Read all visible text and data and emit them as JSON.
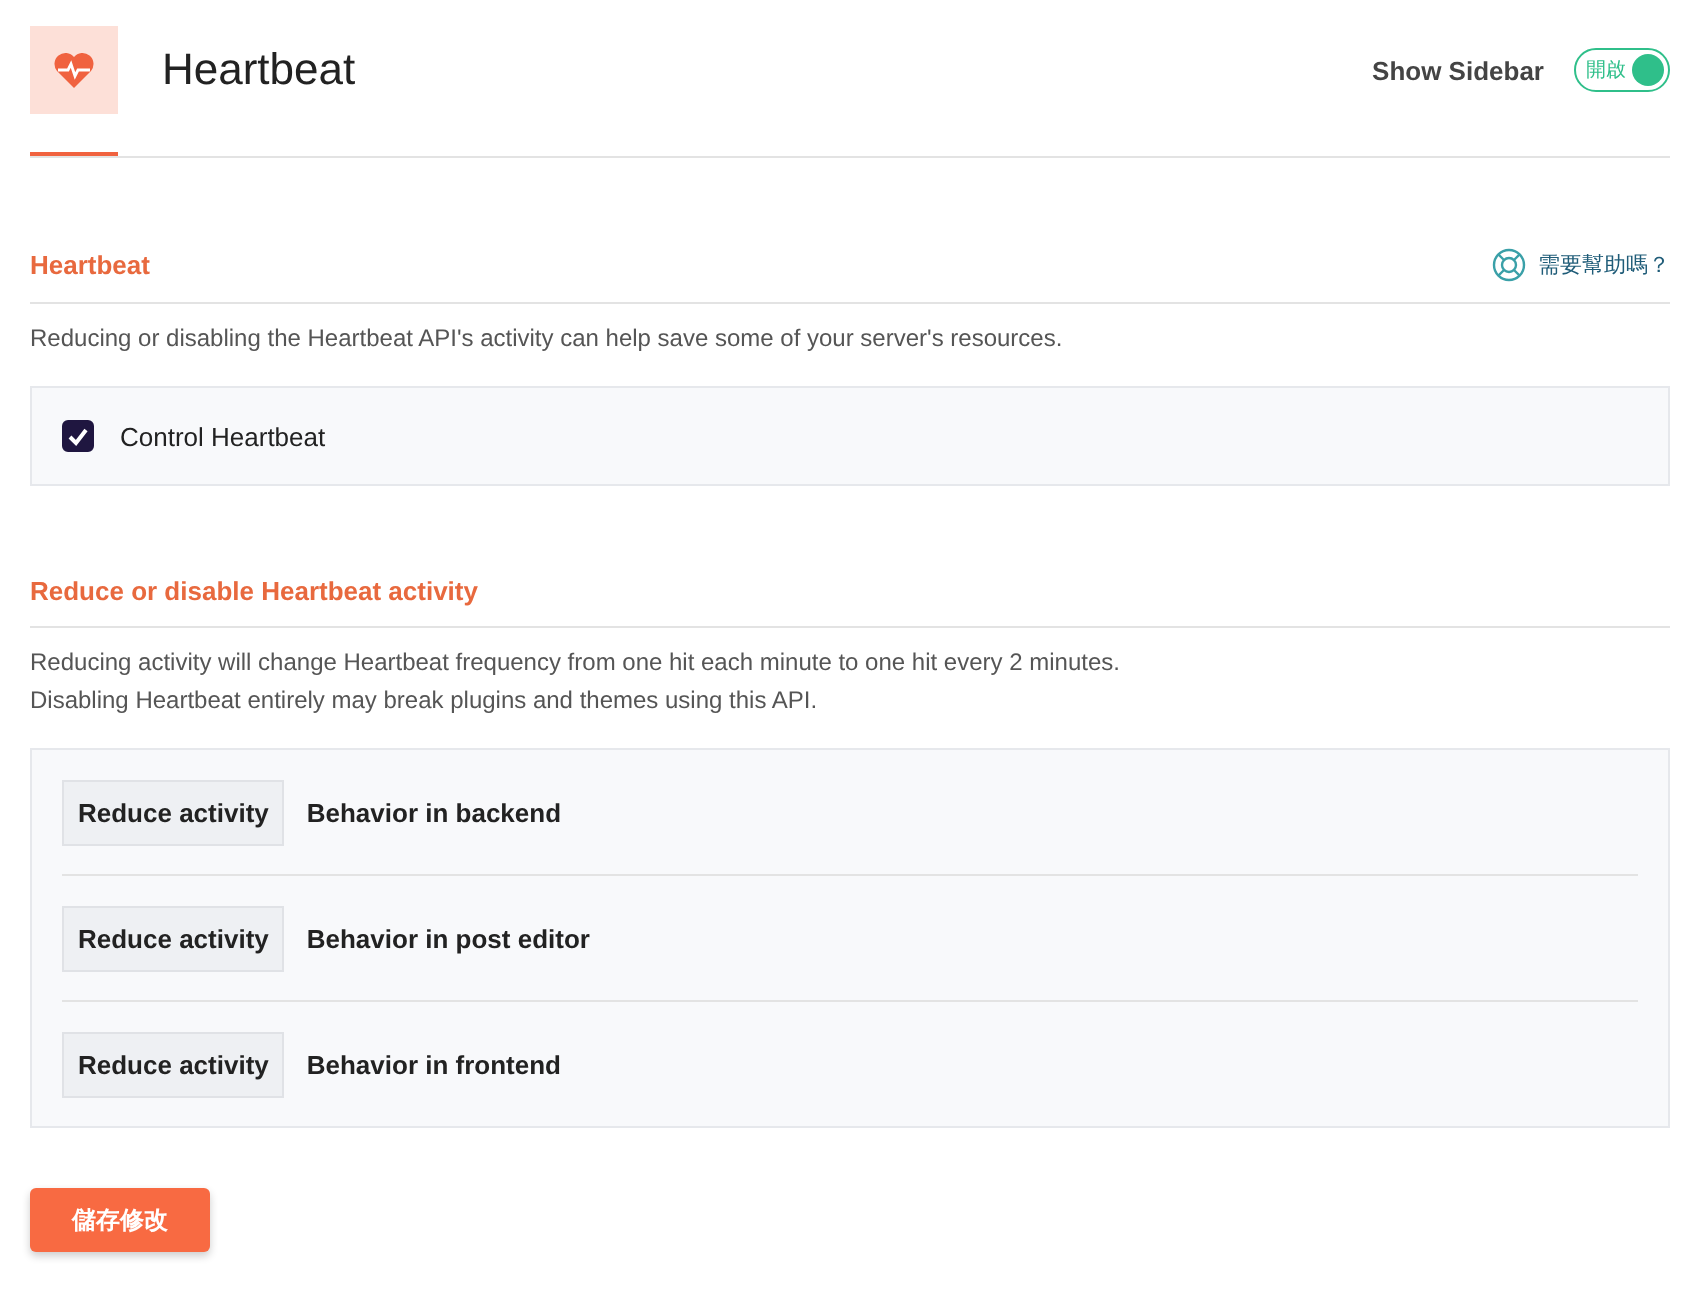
{
  "header": {
    "title": "Heartbeat",
    "sidebar_toggle": {
      "label": "Show Sidebar",
      "state_text": "開啟",
      "on": true
    }
  },
  "sections": [
    {
      "title": "Heartbeat",
      "help_link": "需要幫助嗎？",
      "descriptions": [
        "Reducing or disabling the Heartbeat API's activity can help save some of your server's resources."
      ],
      "options": [
        {
          "kind": "checkbox",
          "label": "Control Heartbeat",
          "checked": true
        }
      ]
    },
    {
      "title": "Reduce or disable Heartbeat activity",
      "descriptions": [
        "Reducing activity will change Heartbeat frequency from one hit each minute to one hit every 2 minutes.",
        "Disabling Heartbeat entirely may break plugins and themes using this API."
      ],
      "options": [
        {
          "kind": "select",
          "value": "Reduce activity",
          "label": "Behavior in backend"
        },
        {
          "kind": "select",
          "value": "Reduce activity",
          "label": "Behavior in post editor"
        },
        {
          "kind": "select",
          "value": "Reduce activity",
          "label": "Behavior in frontend"
        }
      ]
    }
  ],
  "save_button": "儲存修改"
}
